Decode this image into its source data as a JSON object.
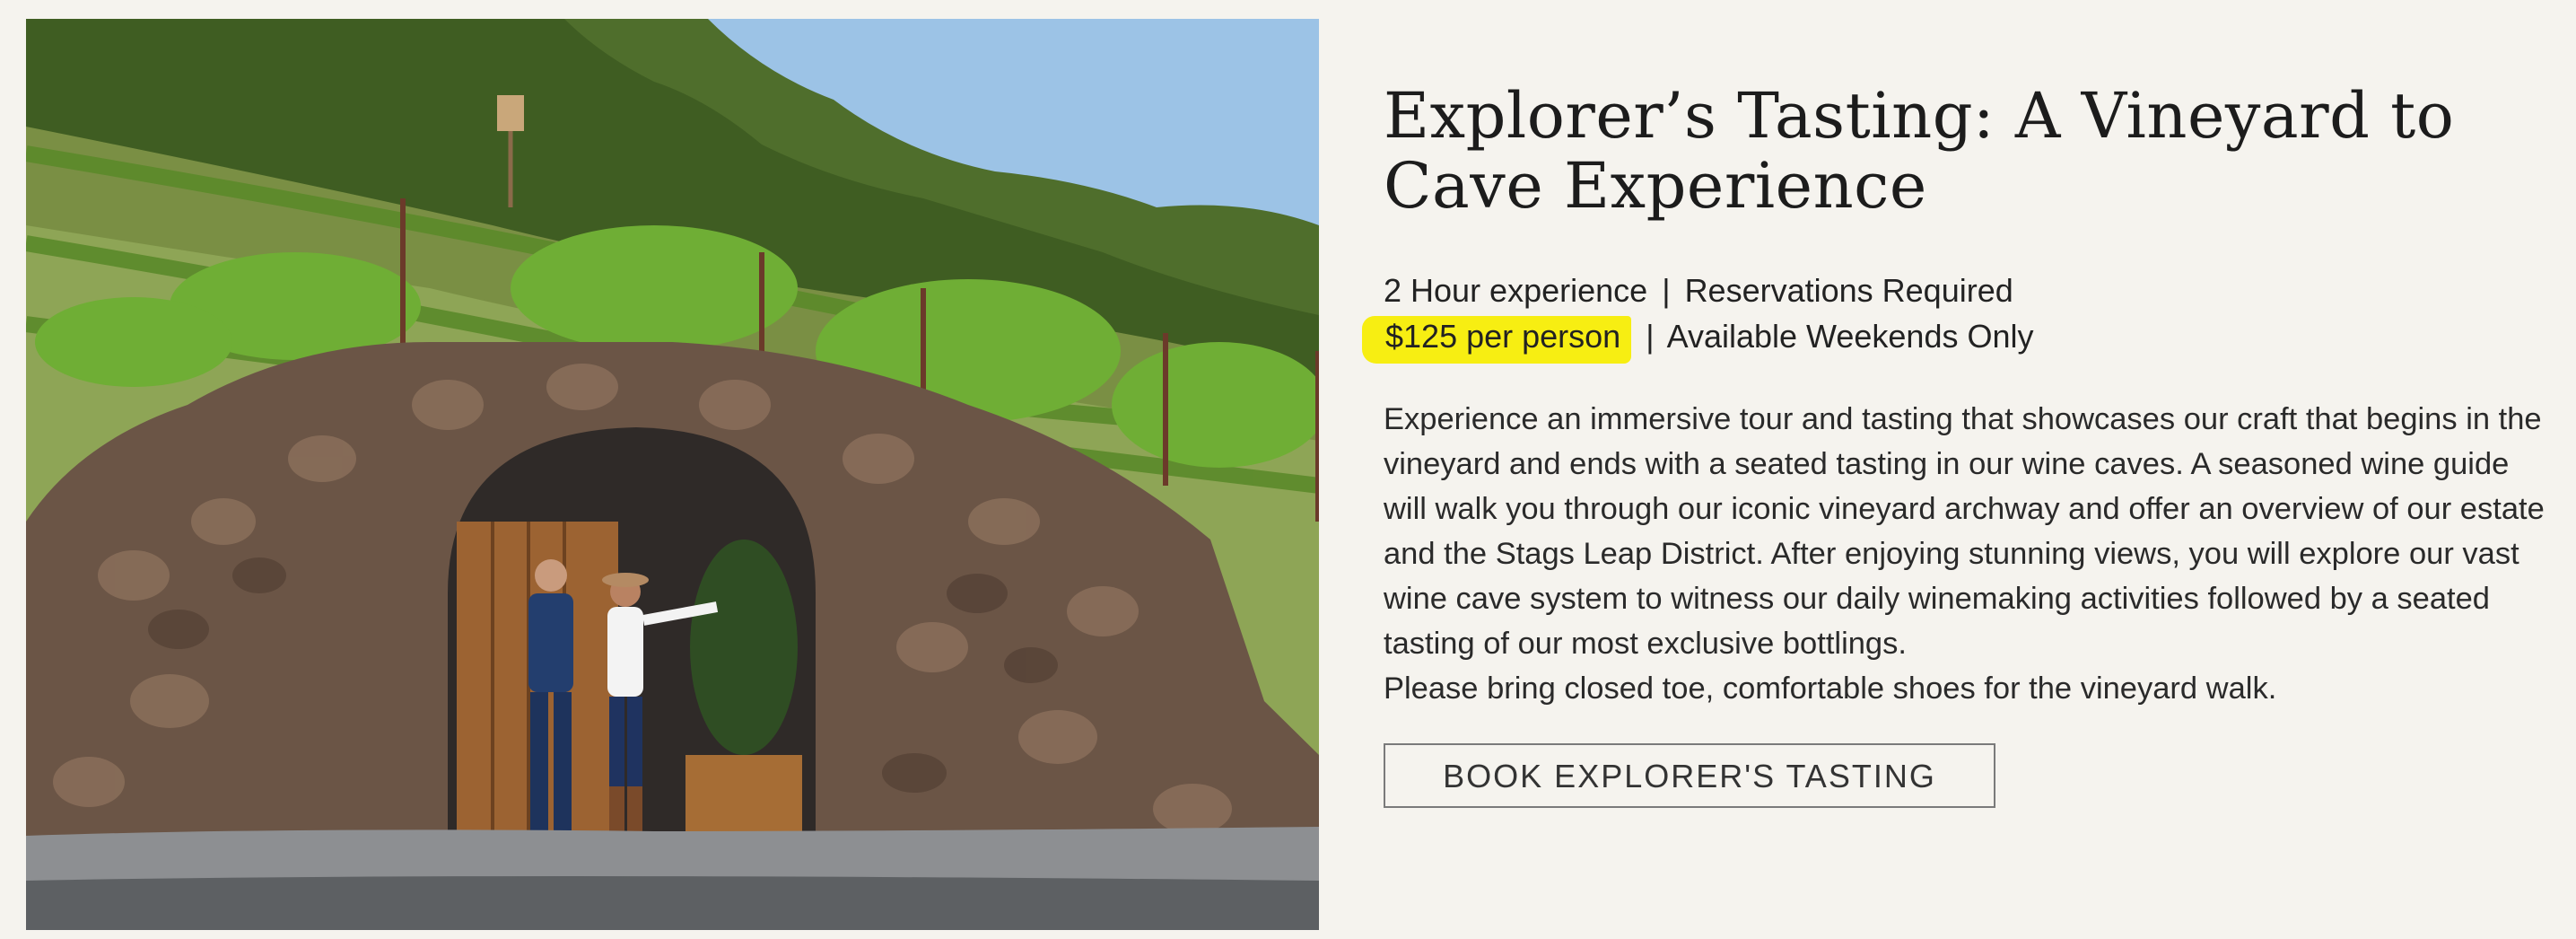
{
  "photo": {
    "alt_subject": "stone-wine-cave-with-vineyard"
  },
  "experience": {
    "title": "Explorer’s Tasting: A Vineyard to Cave Experience",
    "duration": "2 Hour experience",
    "reservations": "Reservations Required",
    "price": "$125 per person",
    "availability": "Available Weekends Only",
    "separator": "|",
    "description": "Experience an immersive tour and tasting that showcases our craft that begins in the vineyard and ends with a seated tasting in our wine caves. A seasoned wine guide will walk you through our iconic vineyard archway and offer an overview of our estate and the Stags Leap District. After enjoying stunning views, you will explore our vast wine cave system to witness our daily winemaking activities followed by a seated tasting of our most exclusive bottlings.",
    "note": "Please bring closed toe, comfortable shoes for the vineyard walk.",
    "cta_label": "BOOK EXPLORER'S TASTING"
  },
  "colors": {
    "background": "#f5f3ee",
    "highlight": "#f7ee12",
    "button_border": "#7a7a7a"
  }
}
